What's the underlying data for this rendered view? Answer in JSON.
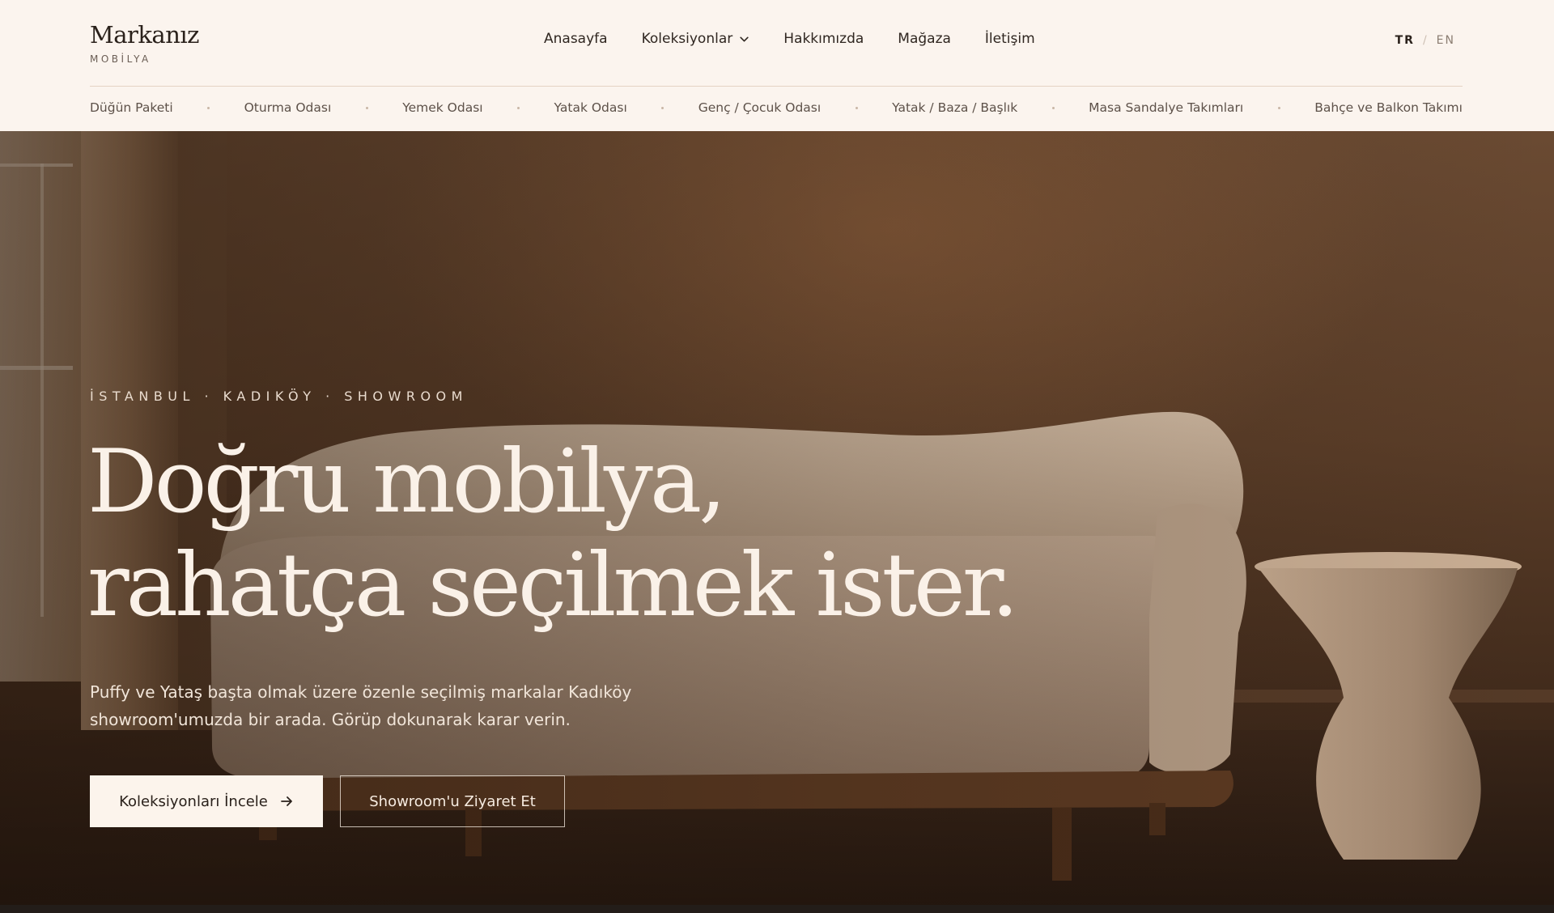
{
  "brand": {
    "name": "Markanız",
    "subtitle": "MOBİLYA"
  },
  "main_nav": [
    {
      "label": "Anasayfa"
    },
    {
      "label": "Koleksiyonlar",
      "icon": "chevron-down-icon"
    },
    {
      "label": "Hakkımızda"
    },
    {
      "label": "Mağaza"
    },
    {
      "label": "İletişim"
    }
  ],
  "language": {
    "active": "TR",
    "separator": "/",
    "other": "EN"
  },
  "categories": [
    "Düğün Paketi",
    "Oturma Odası",
    "Yemek Odası",
    "Yatak Odası",
    "Genç / Çocuk Odası",
    "Yatak / Baza / Başlık",
    "Masa Sandalye Takımları",
    "Bahçe ve Balkon Takımı"
  ],
  "hero": {
    "kicker": "İSTANBUL · KADIKÖY · SHOWROOM",
    "headline_line1": "Doğru mobilya,",
    "headline_line2": "rahatça seçilmek ister.",
    "lead": "Puffy ve Yataş başta olmak üzere özenle seçilmiş markalar Kadıköy showroom'umuzda bir arada. Görüp dokunarak karar verin.",
    "primary_button": {
      "label": "Koleksiyonları İncele",
      "icon": "arrow-right-icon"
    },
    "secondary_button": {
      "label": "Showroom'u Ziyaret Et"
    },
    "image": "curved-boucle-sofa-with-side-table-photo"
  },
  "colors": {
    "header_bg": "#fbf4ee",
    "text_dark": "#2a211b",
    "hero_text": "#faf1e8",
    "button_light": "#fcf4ec"
  }
}
